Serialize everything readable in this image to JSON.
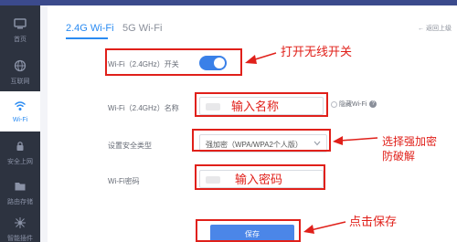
{
  "sidebar": {
    "items": [
      {
        "label": "首页",
        "icon": "dashboard-icon"
      },
      {
        "label": "互联网",
        "icon": "globe-icon"
      },
      {
        "label": "Wi-Fi",
        "icon": "wifi-icon"
      },
      {
        "label": "安全上网",
        "icon": "shield-lock-icon"
      },
      {
        "label": "路由存储",
        "icon": "folder-icon"
      },
      {
        "label": "智能插件",
        "icon": "plugin-icon"
      }
    ],
    "active_index": 2
  },
  "tabs": [
    {
      "label": "2.4G Wi-Fi",
      "active": true
    },
    {
      "label": "5G Wi-Fi",
      "active": false
    }
  ],
  "back_link": "← 返回上级",
  "form": {
    "switch_label": "Wi-Fi（2.4GHz）开关",
    "switch_on": true,
    "name_label": "Wi-Fi（2.4GHz）名称",
    "name_value": "",
    "hide_wifi_label": "隐藏Wi-Fi",
    "help_glyph": "?",
    "security_label": "设置安全类型",
    "security_value": "强加密（WPA/WPA2个人版）",
    "password_label": "Wi-Fi密码",
    "password_value": "",
    "save_label": "保存"
  },
  "annotations": {
    "open_wifi": "打开无线开关",
    "enter_name": "输入名称",
    "choose_security_line1": "选择强加密",
    "choose_security_line2": "防破解",
    "enter_password": "输入密码",
    "click_save": "点击保存"
  },
  "colors": {
    "accent": "#2a8bf2",
    "annotation_red": "#e0201a",
    "sidebar_bg": "#2d3340",
    "toggle_on": "#3a80e8",
    "save_button": "#4b86e8"
  }
}
